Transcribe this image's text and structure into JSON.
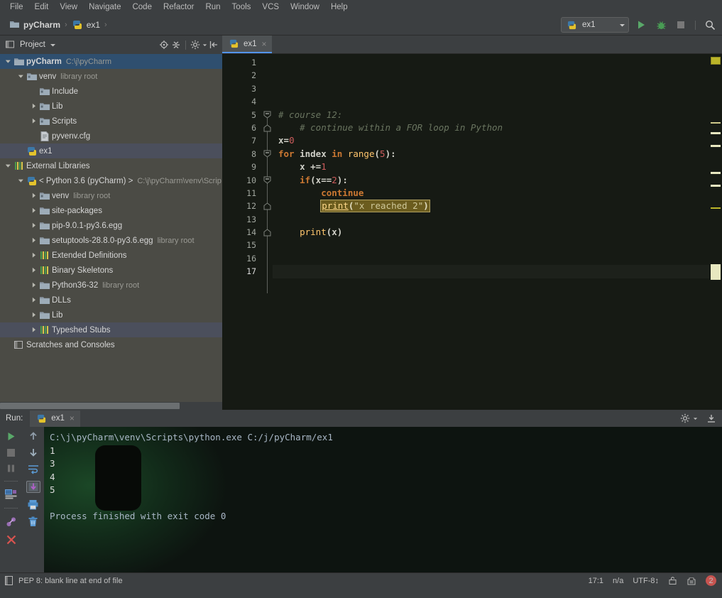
{
  "menubar": {
    "items": [
      "File",
      "Edit",
      "View",
      "Navigate",
      "Code",
      "Refactor",
      "Run",
      "Tools",
      "VCS",
      "Window",
      "Help"
    ]
  },
  "navbar": {
    "crumbs": [
      {
        "label": "pyCharm",
        "icon": "folder-icon",
        "bold": true
      },
      {
        "label": "ex1",
        "icon": "python-file-icon",
        "bold": false
      }
    ],
    "separator": "›",
    "run_config": "ex1",
    "run_button": "run-icon",
    "debug_button": "debug-icon",
    "stop_button": "stop-icon",
    "search_button": "search-icon"
  },
  "sidebar": {
    "title": "Project",
    "header_icons": [
      "locate-icon",
      "collapse-all-icon",
      "settings-icon",
      "hide-icon"
    ],
    "tree": [
      {
        "depth": 0,
        "arrow": "down",
        "icon": "folder-icon",
        "label": "pyCharm",
        "sub": "C:\\j\\pyCharm",
        "bold": true,
        "state": "sel-blue"
      },
      {
        "depth": 1,
        "arrow": "down",
        "icon": "module-icon",
        "label": "venv",
        "sub": "library root",
        "bold": false,
        "state": ""
      },
      {
        "depth": 2,
        "arrow": "none",
        "icon": "module-icon",
        "label": "Include",
        "sub": "",
        "bold": false,
        "state": ""
      },
      {
        "depth": 2,
        "arrow": "right",
        "icon": "module-icon",
        "label": "Lib",
        "sub": "",
        "bold": false,
        "state": ""
      },
      {
        "depth": 2,
        "arrow": "right",
        "icon": "module-icon",
        "label": "Scripts",
        "sub": "",
        "bold": false,
        "state": ""
      },
      {
        "depth": 2,
        "arrow": "none",
        "icon": "cfg-file-icon",
        "label": "pyvenv.cfg",
        "sub": "",
        "bold": false,
        "state": ""
      },
      {
        "depth": 1,
        "arrow": "none",
        "icon": "python-file-icon",
        "label": "ex1",
        "sub": "",
        "bold": false,
        "state": "sel-grey"
      },
      {
        "depth": 0,
        "arrow": "down",
        "icon": "library-icon",
        "label": "External Libraries",
        "sub": "",
        "bold": false,
        "state": ""
      },
      {
        "depth": 1,
        "arrow": "down",
        "icon": "python-icon",
        "label": "< Python 3.6 (pyCharm) >",
        "sub": "C:\\j\\pyCharm\\venv\\Scrip",
        "bold": false,
        "state": ""
      },
      {
        "depth": 2,
        "arrow": "right",
        "icon": "module-icon",
        "label": "venv",
        "sub": "library root",
        "bold": false,
        "state": ""
      },
      {
        "depth": 2,
        "arrow": "right",
        "icon": "folder-icon",
        "label": "site-packages",
        "sub": "",
        "bold": false,
        "state": ""
      },
      {
        "depth": 2,
        "arrow": "right",
        "icon": "folder-icon",
        "label": "pip-9.0.1-py3.6.egg",
        "sub": "",
        "bold": false,
        "state": ""
      },
      {
        "depth": 2,
        "arrow": "right",
        "icon": "folder-icon",
        "label": "setuptools-28.8.0-py3.6.egg",
        "sub": "library root",
        "bold": false,
        "state": ""
      },
      {
        "depth": 2,
        "arrow": "right",
        "icon": "library-icon",
        "label": "Extended Definitions",
        "sub": "",
        "bold": false,
        "state": ""
      },
      {
        "depth": 2,
        "arrow": "right",
        "icon": "library-icon",
        "label": "Binary Skeletons",
        "sub": "",
        "bold": false,
        "state": ""
      },
      {
        "depth": 2,
        "arrow": "right",
        "icon": "folder-icon",
        "label": "Python36-32",
        "sub": "library root",
        "bold": false,
        "state": ""
      },
      {
        "depth": 2,
        "arrow": "right",
        "icon": "folder-icon",
        "label": "DLLs",
        "sub": "",
        "bold": false,
        "state": ""
      },
      {
        "depth": 2,
        "arrow": "right",
        "icon": "folder-icon",
        "label": "Lib",
        "sub": "",
        "bold": false,
        "state": ""
      },
      {
        "depth": 2,
        "arrow": "right",
        "icon": "library-icon",
        "label": "Typeshed Stubs",
        "sub": "",
        "bold": false,
        "state": "sel-grey"
      },
      {
        "depth": 0,
        "arrow": "none",
        "icon": "scratches-icon",
        "label": "Scratches and Consoles",
        "sub": "",
        "bold": false,
        "state": ""
      }
    ]
  },
  "editor": {
    "tab": {
      "label": "ex1",
      "icon": "python-file-icon",
      "close": "×"
    },
    "line_numbers": [
      "1",
      "2",
      "3",
      "4",
      "5",
      "6",
      "7",
      "8",
      "9",
      "10",
      "11",
      "12",
      "13",
      "14",
      "15",
      "16",
      "17"
    ],
    "current_line": 17,
    "lines": [
      {
        "n": 1,
        "tokens": []
      },
      {
        "n": 2,
        "tokens": []
      },
      {
        "n": 3,
        "tokens": []
      },
      {
        "n": 4,
        "tokens": []
      },
      {
        "n": 5,
        "tokens": [
          {
            "t": "cmt",
            "v": "# course 12:"
          }
        ]
      },
      {
        "n": 6,
        "tokens": [
          {
            "t": "cmt",
            "v": "    # continue within a FOR loop in Python"
          }
        ]
      },
      {
        "n": 7,
        "tokens": [
          {
            "t": "pln",
            "v": "x="
          },
          {
            "t": "num",
            "v": "0"
          }
        ]
      },
      {
        "n": 8,
        "tokens": [
          {
            "t": "kw",
            "v": "for"
          },
          {
            "t": "pln",
            "v": " index "
          },
          {
            "t": "kw",
            "v": "in"
          },
          {
            "t": "pln",
            "v": " "
          },
          {
            "t": "fn",
            "v": "range"
          },
          {
            "t": "pln",
            "v": "("
          },
          {
            "t": "num",
            "v": "5"
          },
          {
            "t": "pln",
            "v": "):"
          }
        ]
      },
      {
        "n": 9,
        "tokens": [
          {
            "t": "pln",
            "v": "    x +="
          },
          {
            "t": "num",
            "v": "1"
          }
        ]
      },
      {
        "n": 10,
        "tokens": [
          {
            "t": "kw",
            "v": "    if"
          },
          {
            "t": "pln",
            "v": "(x=="
          },
          {
            "t": "num",
            "v": "2"
          },
          {
            "t": "pln",
            "v": "):"
          }
        ]
      },
      {
        "n": 11,
        "tokens": [
          {
            "t": "kw",
            "v": "        continue"
          }
        ]
      },
      {
        "n": 12,
        "highlight": true,
        "indent": "        ",
        "tokens": [
          {
            "t": "fn",
            "v": "print"
          },
          {
            "t": "pln",
            "v": "("
          },
          {
            "t": "str",
            "v": "\"x reached 2\""
          },
          {
            "t": "pln",
            "v": ")"
          }
        ]
      },
      {
        "n": 13,
        "tokens": []
      },
      {
        "n": 14,
        "tokens": [
          {
            "t": "fn",
            "v": "    print"
          },
          {
            "t": "pln",
            "v": "(x)"
          }
        ]
      },
      {
        "n": 15,
        "tokens": []
      },
      {
        "n": 16,
        "tokens": []
      },
      {
        "n": 17,
        "tokens": []
      }
    ],
    "fold_markers": [
      {
        "line": 5,
        "type": "minus"
      },
      {
        "line": 6,
        "type": "end"
      },
      {
        "line": 8,
        "type": "minus"
      },
      {
        "line": 10,
        "type": "minus"
      },
      {
        "line": 12,
        "type": "end"
      },
      {
        "line": 14,
        "type": "end"
      }
    ]
  },
  "run_panel": {
    "label": "Run:",
    "tab": {
      "label": "ex1",
      "icon": "python-file-icon",
      "close": "×"
    },
    "header_icons": [
      "settings-icon",
      "pin-icon"
    ],
    "toolbar_left": [
      "rerun-icon",
      "stop-icon",
      "pause-icon",
      "console-icon",
      "attach-icon",
      "close-icon"
    ],
    "toolbar_right": [
      "scroll-up-icon",
      "scroll-down-icon",
      "soft-wrap-icon",
      "scroll-to-end-icon",
      "print-icon",
      "trash-icon"
    ],
    "console": [
      {
        "cls": "con-cmd",
        "text": "C:\\j\\pyCharm\\venv\\Scripts\\python.exe C:/j/pyCharm/ex1"
      },
      {
        "cls": "con-out",
        "text": "1"
      },
      {
        "cls": "con-out",
        "text": "3"
      },
      {
        "cls": "con-out",
        "text": "4"
      },
      {
        "cls": "con-out",
        "text": "5"
      },
      {
        "cls": "con-out",
        "text": ""
      },
      {
        "cls": "con-fin",
        "text": "Process finished with exit code 0"
      }
    ]
  },
  "statusbar": {
    "message": "PEP 8: blank line at end of file",
    "caret": "17:1",
    "line_sep": "n/a",
    "encoding": "UTF-8↕",
    "lock_icon": "lock-icon",
    "vcs_icon": "vcs-icon",
    "error_count": "2"
  },
  "colors": {
    "accent_blue": "#5394ec",
    "panel_bg": "#3c3f41",
    "tree_bg": "#4b4b45",
    "editor_bg": "#161a14",
    "console_bg": "#0d1410",
    "selection_blue": "#2f4f6f",
    "keyword_orange": "#cc7832",
    "function_yellow": "#ffc66d",
    "number_red": "#cd5c5c",
    "string_olive": "#a5a06a",
    "comment_gray": "#6a7560",
    "error_red": "#c75450",
    "warn_yellow": "#bbb529"
  }
}
